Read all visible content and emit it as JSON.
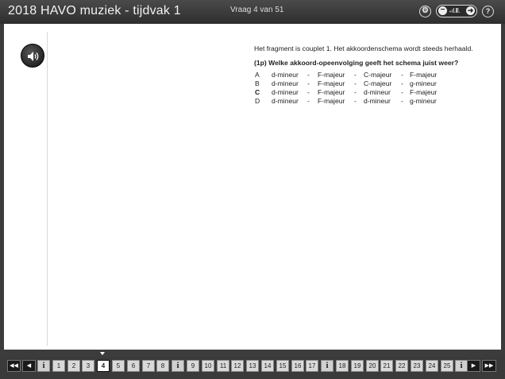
{
  "header": {
    "title": "2018 HAVO muziek - tijdvak 1",
    "counter": "Vraag 4 van 51",
    "zoom_level": "₊ıl.lll."
  },
  "icons": {
    "settings": "settings-icon",
    "zoom_minus": "minus-icon",
    "zoom_plus": "plus-arrow-icon",
    "help": "help-icon",
    "audio": "speaker-icon",
    "first": "double-left-arrow-icon",
    "prev": "left-arrow-icon",
    "next": "right-arrow-icon",
    "last": "double-right-arrow-icon",
    "info": "info-icon"
  },
  "question": {
    "intro": "Het fragment is couplet 1. Het akkoordenschema wordt steeds herhaald.",
    "prompt": "(1p) Welke akkoord-opeenvolging geeft het schema juist weer?",
    "separator": "-",
    "options": [
      {
        "letter": "A",
        "chords": [
          "d-mineur",
          "F-majeur",
          "C-majeur",
          "F-majeur"
        ]
      },
      {
        "letter": "B",
        "chords": [
          "d-mineur",
          "F-majeur",
          "C-majeur",
          "g-mineur"
        ]
      },
      {
        "letter": "C",
        "chords": [
          "d-mineur",
          "F-majeur",
          "d-mineur",
          "F-majeur"
        ]
      },
      {
        "letter": "D",
        "chords": [
          "d-mineur",
          "F-majeur",
          "d-mineur",
          "g-mineur"
        ]
      }
    ]
  },
  "nav": {
    "first": "◀◀",
    "prev": "◀",
    "next": "▶",
    "last": "▶▶",
    "info": "i",
    "current": "4",
    "items": [
      "i",
      "1",
      "2",
      "3",
      "4",
      "5",
      "6",
      "7",
      "8",
      "i",
      "9",
      "10",
      "11",
      "12",
      "13",
      "14",
      "15",
      "16",
      "17",
      "i",
      "18",
      "19",
      "20",
      "21",
      "22",
      "23",
      "24",
      "25",
      "i"
    ]
  },
  "colors": {
    "header_bg": "#3a3a3a",
    "content_bg": "#ffffff",
    "current_page": "#ffffff"
  }
}
